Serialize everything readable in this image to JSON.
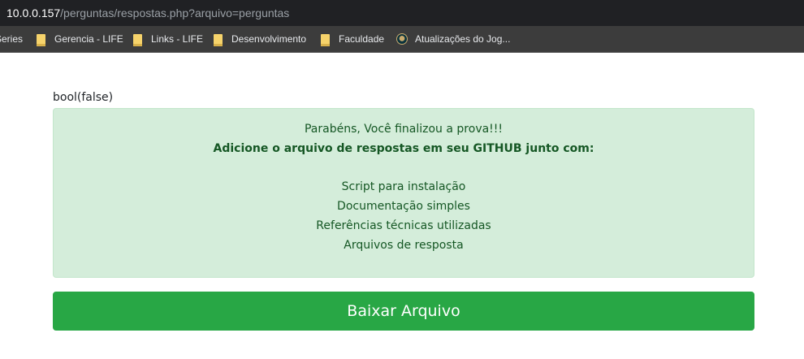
{
  "browser": {
    "url_host": "10.0.0.157",
    "url_path": "/perguntas/respostas.php?arquivo=perguntas",
    "bookmarks": [
      {
        "label": "Series",
        "icon": "none"
      },
      {
        "label": "Gerencia - LIFE",
        "icon": "folder-icon"
      },
      {
        "label": "Links - LIFE",
        "icon": "folder-icon"
      },
      {
        "label": "Desenvolvimento",
        "icon": "folder-icon"
      },
      {
        "label": "Faculdade",
        "icon": "folder-icon"
      },
      {
        "label": "Atualizações do Jog...",
        "icon": "league-of-legends-icon"
      }
    ]
  },
  "page": {
    "debug_output": "bool(false)",
    "alert": {
      "line1": "Parabéns, Você finalizou a prova!!!",
      "line2": "Adicione o arquivo de respostas em seu GITHUB junto com:",
      "items": [
        "Script para instalação",
        "Documentação simples",
        "Referências técnicas utilizadas",
        "Arquivos de resposta"
      ]
    },
    "download_button": "Baixar Arquivo"
  },
  "colors": {
    "alert_bg": "#d4edda",
    "alert_text": "#155724",
    "button_bg": "#28a745",
    "chrome_dark": "#202124"
  }
}
